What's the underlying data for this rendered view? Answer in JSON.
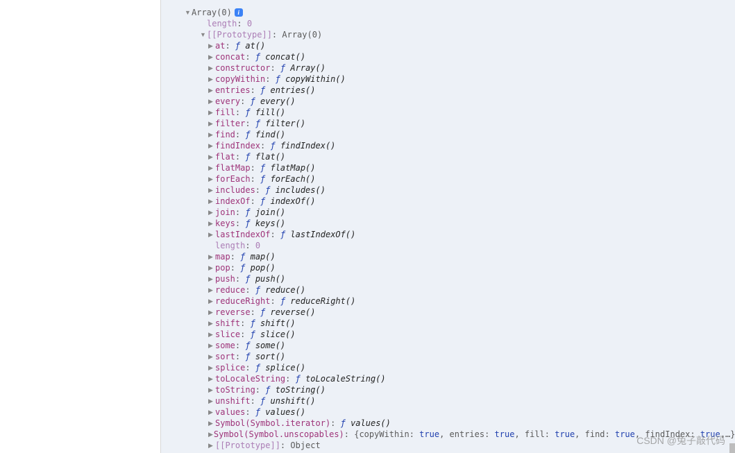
{
  "root": {
    "label": "Array(0)"
  },
  "length_top": {
    "key": "length",
    "val": "0"
  },
  "proto_line": {
    "key": "[[Prototype]]",
    "val": "Array(0)"
  },
  "methods": [
    {
      "key": "at",
      "fn": "at()"
    },
    {
      "key": "concat",
      "fn": "concat()"
    },
    {
      "key": "constructor",
      "fn": "Array()"
    },
    {
      "key": "copyWithin",
      "fn": "copyWithin()"
    },
    {
      "key": "entries",
      "fn": "entries()"
    },
    {
      "key": "every",
      "fn": "every()"
    },
    {
      "key": "fill",
      "fn": "fill()"
    },
    {
      "key": "filter",
      "fn": "filter()"
    },
    {
      "key": "find",
      "fn": "find()"
    },
    {
      "key": "findIndex",
      "fn": "findIndex()"
    },
    {
      "key": "flat",
      "fn": "flat()"
    },
    {
      "key": "flatMap",
      "fn": "flatMap()"
    },
    {
      "key": "forEach",
      "fn": "forEach()"
    },
    {
      "key": "includes",
      "fn": "includes()"
    },
    {
      "key": "indexOf",
      "fn": "indexOf()"
    },
    {
      "key": "join",
      "fn": "join()"
    },
    {
      "key": "keys",
      "fn": "keys()"
    },
    {
      "key": "lastIndexOf",
      "fn": "lastIndexOf()"
    }
  ],
  "length_inner": {
    "key": "length",
    "val": "0"
  },
  "methods2": [
    {
      "key": "map",
      "fn": "map()"
    },
    {
      "key": "pop",
      "fn": "pop()"
    },
    {
      "key": "push",
      "fn": "push()"
    },
    {
      "key": "reduce",
      "fn": "reduce()"
    },
    {
      "key": "reduceRight",
      "fn": "reduceRight()"
    },
    {
      "key": "reverse",
      "fn": "reverse()"
    },
    {
      "key": "shift",
      "fn": "shift()"
    },
    {
      "key": "slice",
      "fn": "slice()"
    },
    {
      "key": "some",
      "fn": "some()"
    },
    {
      "key": "sort",
      "fn": "sort()"
    },
    {
      "key": "splice",
      "fn": "splice()"
    },
    {
      "key": "toLocaleString",
      "fn": "toLocaleString()"
    },
    {
      "key": "toString",
      "fn": "toString()"
    },
    {
      "key": "unshift",
      "fn": "unshift()"
    },
    {
      "key": "values",
      "fn": "values()"
    }
  ],
  "symbol_iterator": {
    "key": "Symbol(Symbol.iterator)",
    "fn": "values()"
  },
  "symbol_unscopables": {
    "key": "Symbol(Symbol.unscopables)",
    "preview_open": "{",
    "fields": [
      {
        "k": "copyWithin",
        "v": "true"
      },
      {
        "k": "entries",
        "v": "true"
      },
      {
        "k": "fill",
        "v": "true"
      },
      {
        "k": "find",
        "v": "true"
      },
      {
        "k": "findIndex",
        "v": "true"
      }
    ],
    "tail": ",…}"
  },
  "proto_bottom": {
    "key": "[[Prototype]]",
    "val": "Object"
  },
  "watermark": "CSDN @兔子敲代码"
}
